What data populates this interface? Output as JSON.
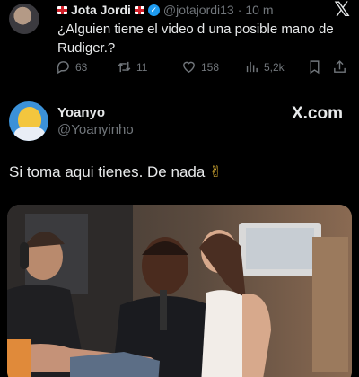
{
  "reply_tweet": {
    "display_name": "Jota Jordi",
    "handle": "@jotajordi13",
    "separator": "·",
    "time": "10 m",
    "text": "¿Alguien tiene el video d una posible mano de Rudiger.?",
    "stats": {
      "replies": "63",
      "retweets": "11",
      "likes": "158",
      "views": "5,2k"
    },
    "icons": [
      "x-logo-icon",
      "verified-badge-icon",
      "england-flag-icon",
      "reply-icon",
      "retweet-icon",
      "like-icon",
      "views-icon",
      "bookmark-icon",
      "share-icon"
    ]
  },
  "main_tweet": {
    "display_name": "Yoanyo",
    "handle": "@Yoanyinho",
    "brand": "X.com",
    "text": "Si toma aqui tienes. De nada",
    "emoji": "✌",
    "media_description_icons": [
      "photo-media"
    ]
  },
  "theme": {
    "background": "#000000",
    "text_primary": "#e7e9ea",
    "text_secondary": "#71767b",
    "verified_blue": "#1d9bf0"
  }
}
